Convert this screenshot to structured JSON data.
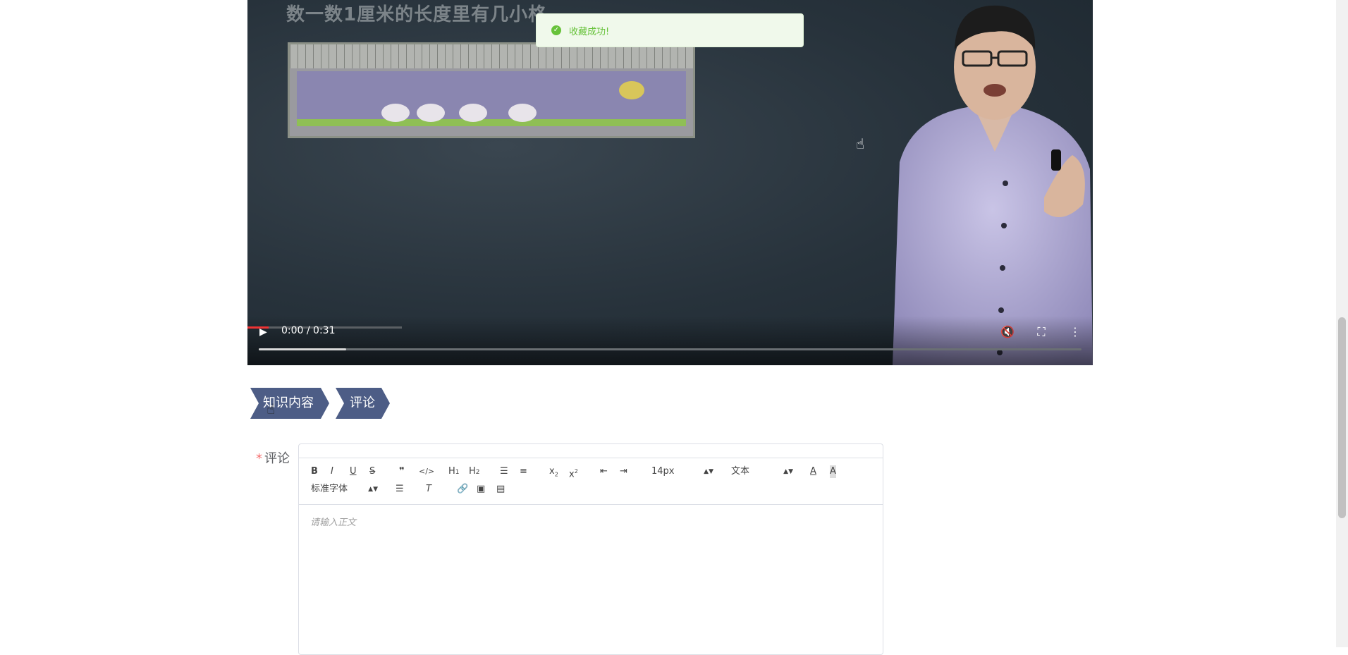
{
  "video": {
    "slide_title": "数一数1厘米的长度里有几小格",
    "current_time": "0:00 / 0:31",
    "played_fraction": 0.0,
    "buffered_fraction": 0.106
  },
  "toast": {
    "message": "收藏成功!",
    "type": "success",
    "color": "#67c23a"
  },
  "tabs": [
    {
      "label": "知识内容"
    },
    {
      "label": "评论"
    }
  ],
  "form": {
    "comment_label": "评论",
    "required_mark": "*"
  },
  "editor": {
    "font_size": "14px",
    "paragraph_type": "文本",
    "font_family": "标准字体",
    "placeholder": "请输入正文"
  },
  "colors": {
    "tab_bg": "#4d5d86",
    "toast_bg": "#f0f9eb",
    "required": "#f56c6c"
  }
}
